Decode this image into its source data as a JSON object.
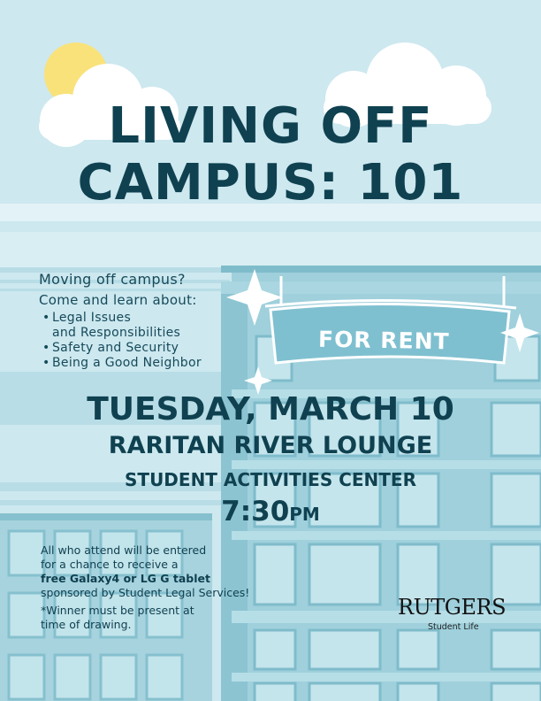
{
  "title": {
    "line1": "LIVING OFF",
    "line2": "CAMPUS: 101"
  },
  "intro": {
    "question": "Moving off campus?",
    "lead": "Come and learn about:"
  },
  "topics": [
    "Legal Issues\nand Responsibilities",
    "Safety and Security",
    "Being a Good Neighbor"
  ],
  "sign": {
    "text": "FOR RENT"
  },
  "event": {
    "date": "TUESDAY, MARCH 10",
    "venue": "RARITAN RIVER LOUNGE",
    "building": "STUDENT ACTIVITIES CENTER",
    "time": "7:30",
    "time_suffix": "PM"
  },
  "prize": {
    "line1": "All who attend will be entered",
    "line2": "for a chance to receive a",
    "line3": "free Galaxy4 or LG G tablet",
    "line4": "sponsored by Student Legal Services!",
    "note1": "*Winner must be present at",
    "note2": "time of drawing."
  },
  "logo": {
    "name": "RUTGERS",
    "sub": "Student Life"
  },
  "colors": {
    "sky": "#cde8ef",
    "ink": "#0f4150",
    "building": "#8fc7d4",
    "sun": "#f9e27a"
  }
}
